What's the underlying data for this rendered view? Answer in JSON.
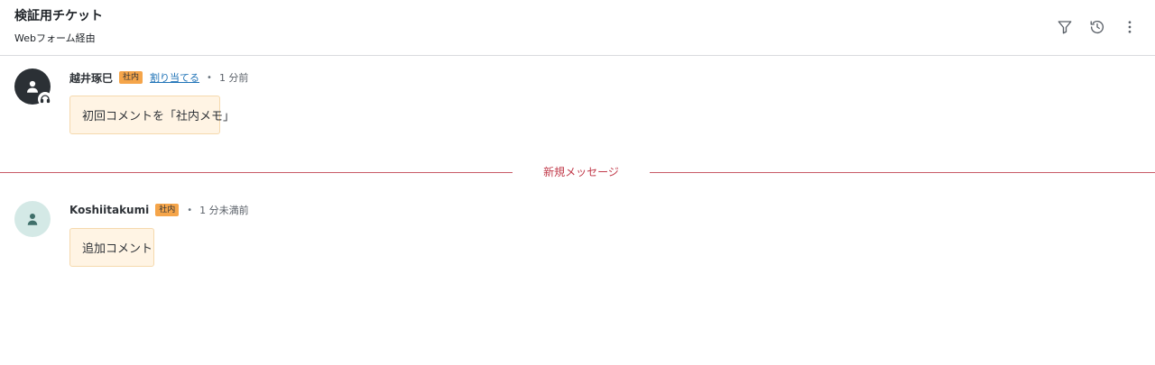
{
  "header": {
    "title": "検証用チケット",
    "subtitle": "Webフォーム経由",
    "actions": [
      {
        "name": "filter-icon"
      },
      {
        "name": "history-icon"
      },
      {
        "name": "more-vertical-icon"
      }
    ]
  },
  "comments": [
    {
      "author": "越井琢巳",
      "badge": "社内",
      "assign_link": "割り当てる",
      "separator": "•",
      "time": "1 分前",
      "body": "初回コメントを「社内メモ」",
      "avatar_type": "agent"
    },
    {
      "author": "Koshiitakumi",
      "badge": "社内",
      "separator": "•",
      "time": "1 分未満前",
      "body": "追加コメント",
      "avatar_type": "user"
    }
  ],
  "divider": {
    "label": "新規メッセージ"
  },
  "colors": {
    "badge": "#f5a54a",
    "bubble_bg": "#fff4e4",
    "divider": "#c85b67",
    "link": "#1f73b7",
    "agent_avatar": "#2b3035",
    "user_avatar": "#d4e9e6"
  }
}
